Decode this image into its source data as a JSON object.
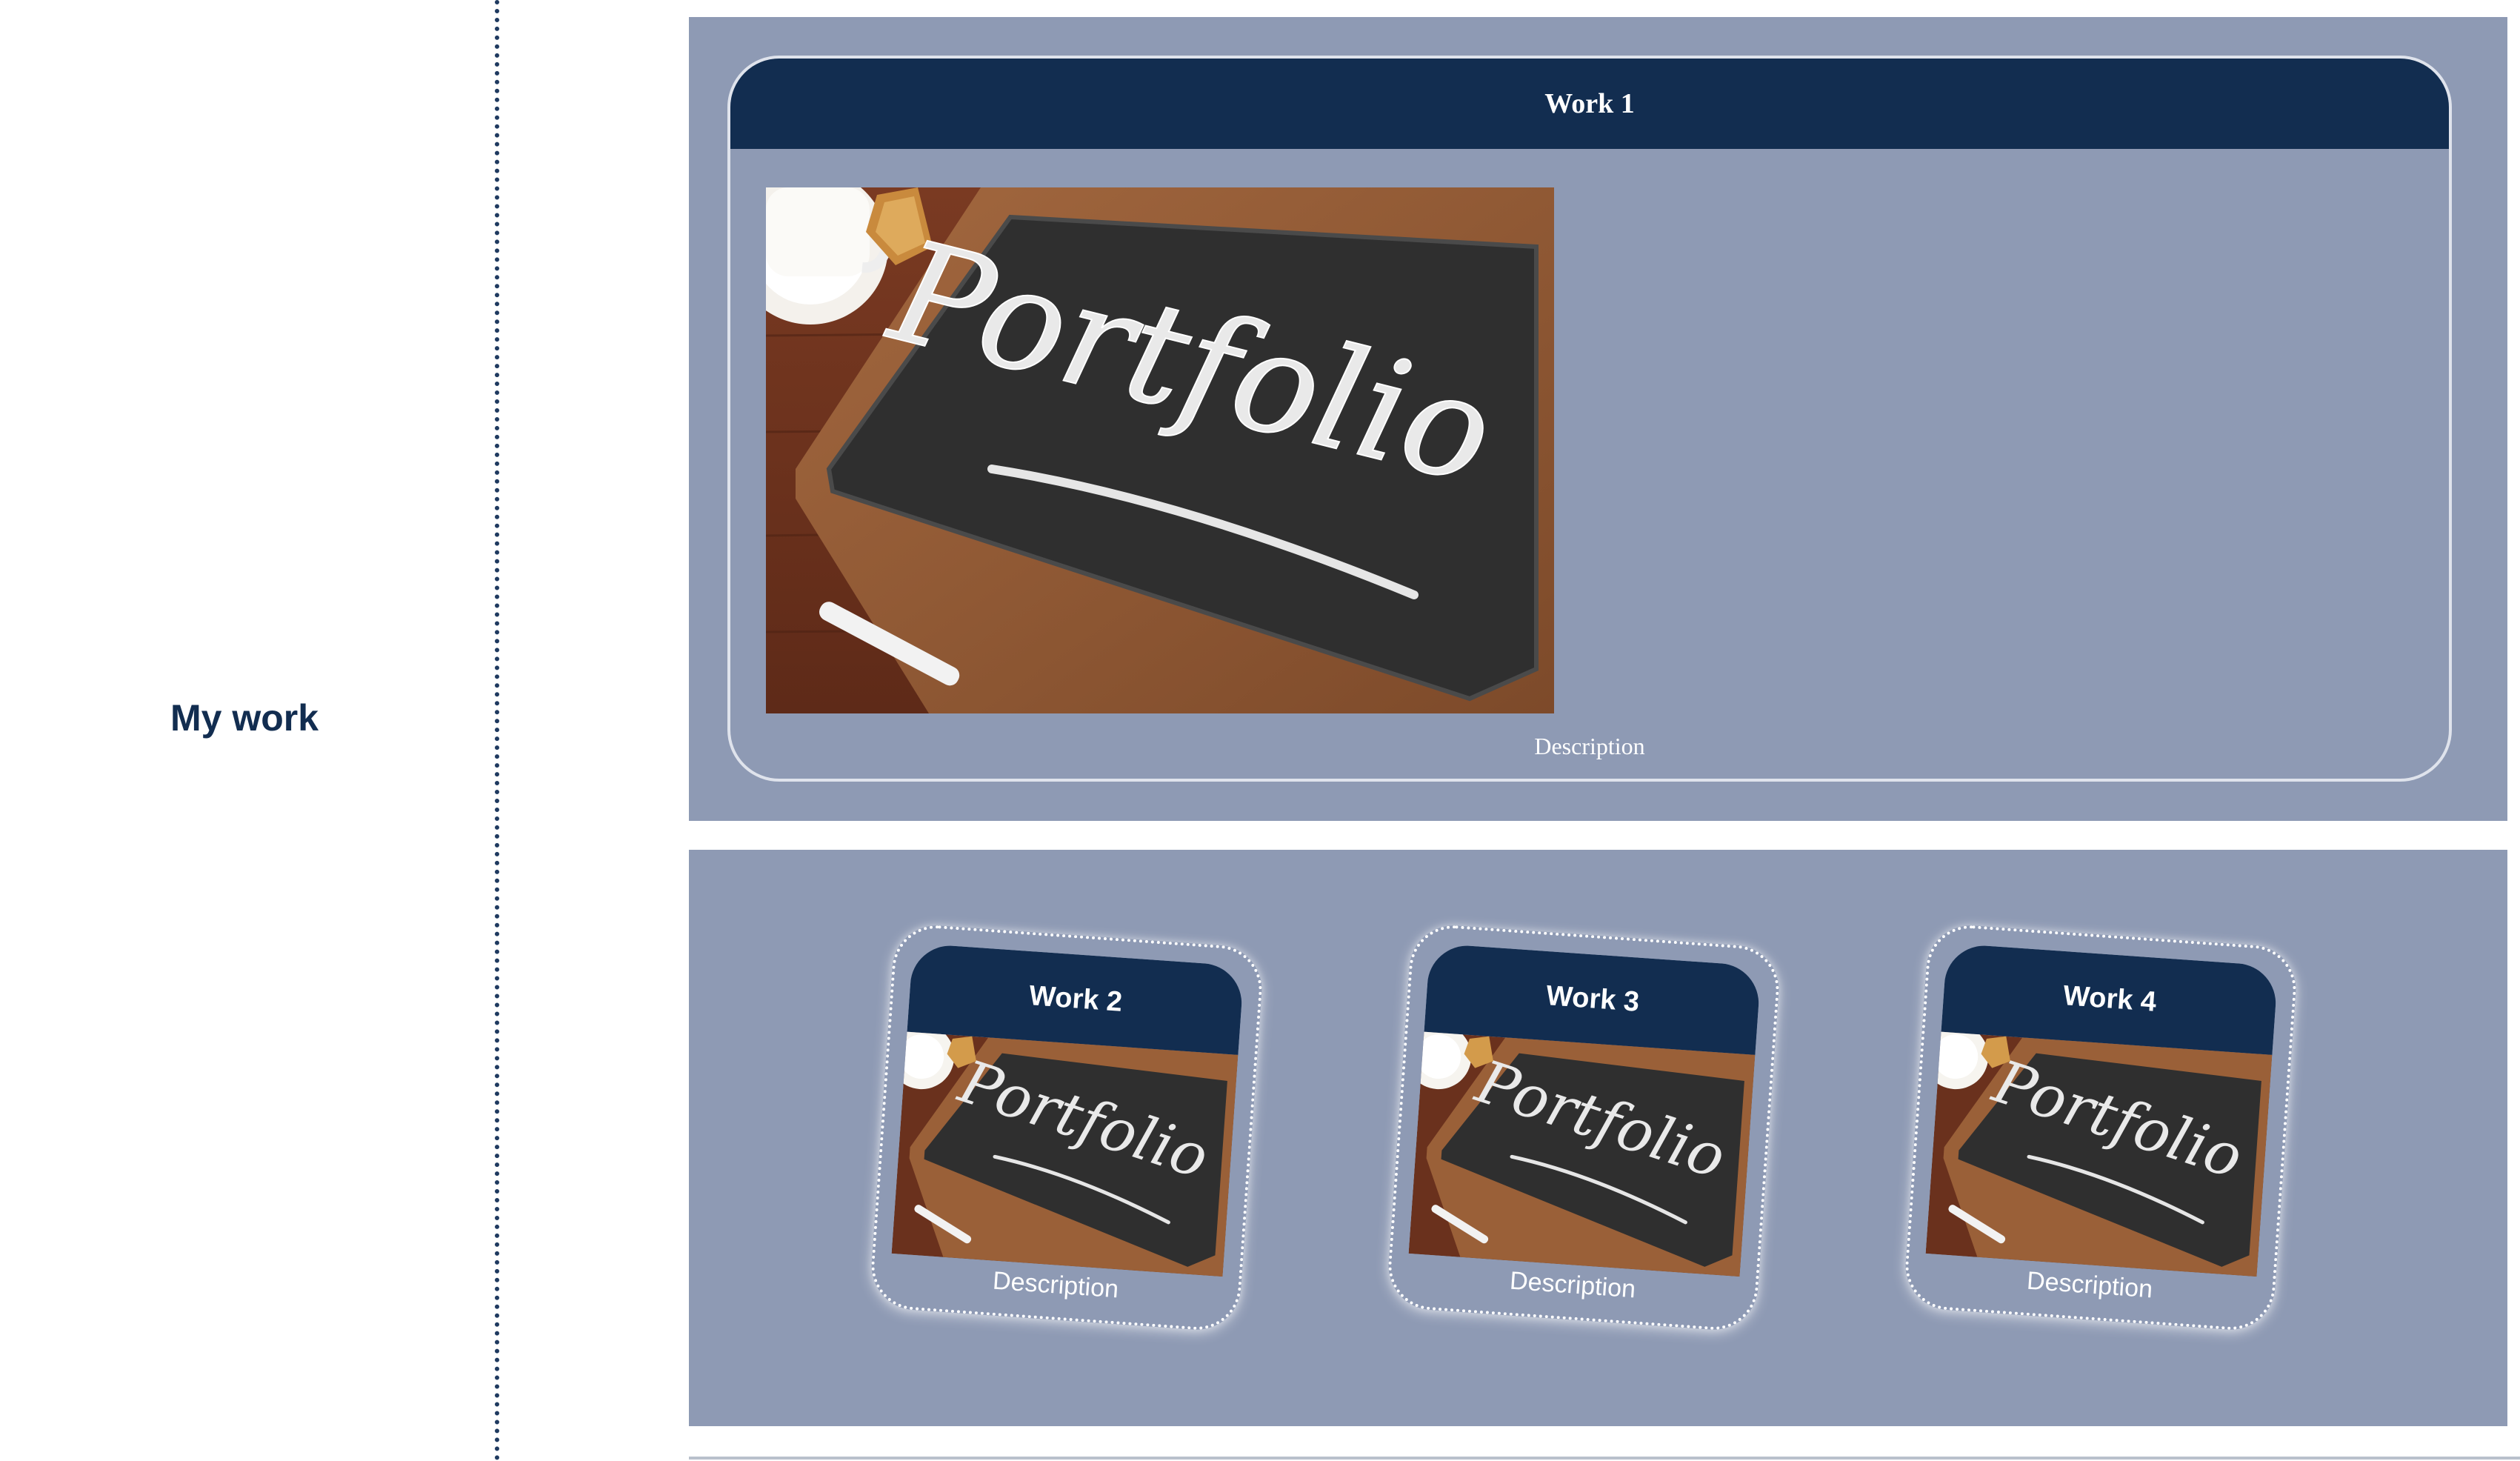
{
  "sidebar": {
    "title": "My work"
  },
  "featured": {
    "title": "Work 1",
    "image_text": "Portfolio",
    "description": "Description"
  },
  "works": [
    {
      "title": "Work 2",
      "image_text": "Portfolio",
      "description": "Description"
    },
    {
      "title": "Work 3",
      "image_text": "Portfolio",
      "description": "Description"
    },
    {
      "title": "Work 4",
      "image_text": "Portfolio",
      "description": "Description"
    }
  ],
  "colors": {
    "navy": "#122d50",
    "panel": "#8e9ab4",
    "white": "#ffffff"
  }
}
